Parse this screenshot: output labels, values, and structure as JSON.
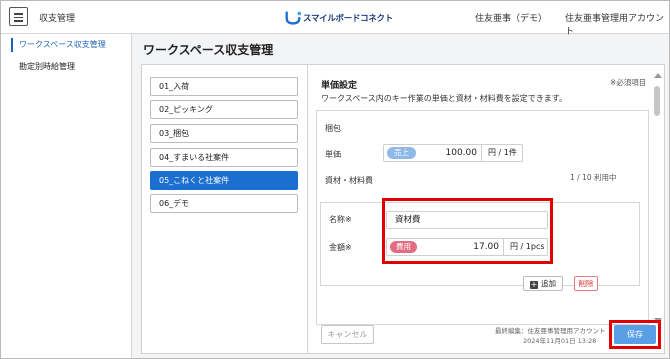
{
  "header": {
    "app_title": "収支管理",
    "logo_text": "スマイルボードコネクト",
    "user_name": "住友亜事（デモ）",
    "account_name": "住友亜事管理用アカウント"
  },
  "sidebar": {
    "items": [
      {
        "label": "ワークスペース収支管理",
        "active": true
      },
      {
        "label": "勘定別時給管理",
        "active": false
      }
    ]
  },
  "page": {
    "title": "ワークスペース収支管理"
  },
  "workspaces": [
    {
      "label": "01_入荷",
      "selected": false
    },
    {
      "label": "02_ピッキング",
      "selected": false
    },
    {
      "label": "03_梱包",
      "selected": false
    },
    {
      "label": "04_すまいる社案件",
      "selected": false
    },
    {
      "label": "05_こねくと社案件",
      "selected": true
    },
    {
      "label": "06_デモ",
      "selected": false
    }
  ],
  "detail": {
    "section_title": "単価設定",
    "required_note": "※必須項目",
    "description": "ワークスペース内のキー作業の単価と資材・材料費を設定できます。",
    "packaging": {
      "heading": "梱包",
      "price_label": "単価",
      "price_tag": "売上",
      "price_value": "100.00",
      "price_unit": "円 / 1件"
    },
    "materials": {
      "heading": "資材・材料費",
      "count": "1 / 10 利用中",
      "name_label": "名称※",
      "name_value": "資材費",
      "amount_label": "金額※",
      "amount_tag": "費用",
      "amount_value": "17.00",
      "amount_unit": "円 / 1pcs",
      "add_label": "追加",
      "delete_label": "削除"
    }
  },
  "footer": {
    "cancel_label": "キャンセル",
    "last_edit": "最終編集：住友亜事管理用アカウント",
    "edit_date": "2024年11月01日 13:28",
    "save_label": "保存"
  },
  "colors": {
    "accent": "#1a6fd0",
    "save": "#5a9fe5",
    "sales_tag": "#8fb9e6",
    "cost_tag": "#e46c80",
    "highlight": "#e00000"
  }
}
